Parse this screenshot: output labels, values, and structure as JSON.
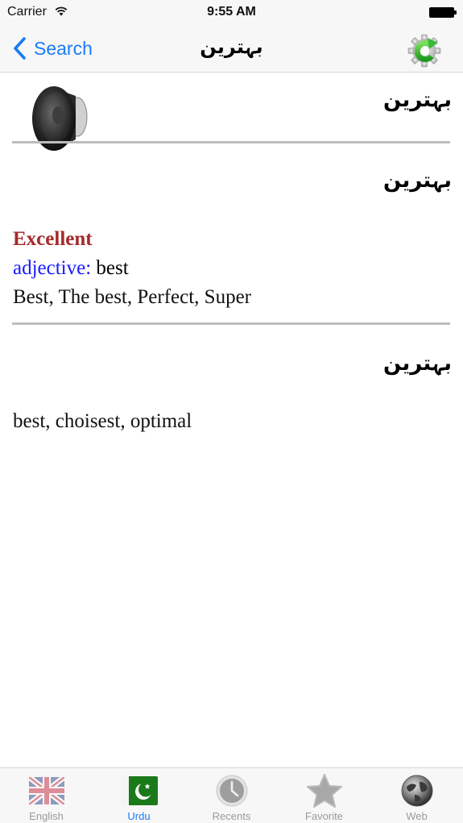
{
  "status_bar": {
    "carrier": "Carrier",
    "time": "9:55 AM",
    "wifi_icon": "wifi-icon",
    "battery_icon": "battery-icon"
  },
  "nav_bar": {
    "back_label": "Search",
    "back_icon": "chevron-left-icon",
    "title": "بہترین",
    "settings_icon": "gear-refresh-icon"
  },
  "entry": {
    "word_urdu": "بہترین",
    "speaker_icon": "speaker-icon",
    "sections": [
      {
        "urdu": "بہترین",
        "headword": "Excellent",
        "part_of_speech": "adjective:",
        "meaning": " best",
        "synonyms": "Best, The best, Perfect, Super"
      },
      {
        "urdu": "بہترین",
        "translations": "best, choisest, optimal"
      }
    ]
  },
  "colors": {
    "accent": "#1a7cf5",
    "headword": "#a52a2a",
    "part_of_speech": "#1a1aff",
    "divider": "#bdbdbd"
  },
  "tab_bar": {
    "active_index": 1,
    "tabs": [
      {
        "label": "English",
        "icon": "uk-flag-icon"
      },
      {
        "label": "Urdu",
        "icon": "pakistan-flag-icon"
      },
      {
        "label": "Recents",
        "icon": "clock-icon"
      },
      {
        "label": "Favorite",
        "icon": "star-icon"
      },
      {
        "label": "Web",
        "icon": "globe-icon"
      }
    ]
  }
}
